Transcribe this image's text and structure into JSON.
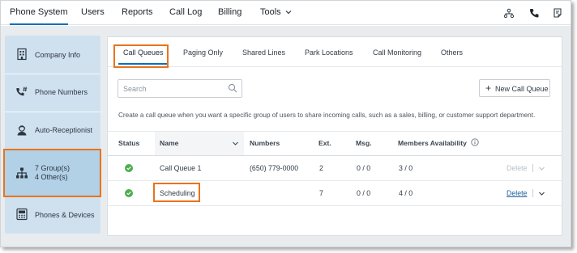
{
  "topnav": {
    "items": [
      {
        "label": "Phone System"
      },
      {
        "label": "Users"
      },
      {
        "label": "Reports"
      },
      {
        "label": "Call Log"
      },
      {
        "label": "Billing"
      },
      {
        "label": "Tools"
      }
    ],
    "right_icons": [
      "directory-icon",
      "phone-icon",
      "notes-icon"
    ]
  },
  "sidebar": {
    "items": [
      {
        "label": "Company Info",
        "icon": "building-icon"
      },
      {
        "label": "Phone Numbers",
        "icon": "phone-hash-icon"
      },
      {
        "label": "Auto-Receptionist",
        "icon": "receptionist-icon"
      },
      {
        "label_line1": "7 Group(s)",
        "label_line2": "4 Other(s)",
        "icon": "org-chart-icon"
      },
      {
        "label": "Phones & Devices",
        "icon": "devices-icon"
      }
    ]
  },
  "tabs": [
    {
      "label": "Call Queues"
    },
    {
      "label": "Paging Only"
    },
    {
      "label": "Shared Lines"
    },
    {
      "label": "Park Locations"
    },
    {
      "label": "Call Monitoring"
    },
    {
      "label": "Others"
    }
  ],
  "search": {
    "placeholder": "Search",
    "value": ""
  },
  "new_button": {
    "label": "New Call Queue"
  },
  "description": "Create a call queue when you want a specific group of users to share incoming calls, such as a sales, billing, or customer support department.",
  "table": {
    "headers": [
      "Status",
      "Name",
      "Numbers",
      "Ext.",
      "Msg.",
      "Members Availability"
    ],
    "rows": [
      {
        "name": "Call Queue 1",
        "numbers": "(650) 779-0000",
        "ext": "2",
        "msg": "0 / 0",
        "members": "3 / 0",
        "delete": "Delete"
      },
      {
        "name": "Scheduling",
        "numbers": "",
        "ext": "7",
        "msg": "0 / 0",
        "members": "4 / 0",
        "delete": "Delete"
      }
    ]
  },
  "colors": {
    "accent": "#0a6ebd",
    "highlight": "#e8741c",
    "status_green": "#4caf50",
    "sidebar_bg": "#cfe1ef"
  }
}
